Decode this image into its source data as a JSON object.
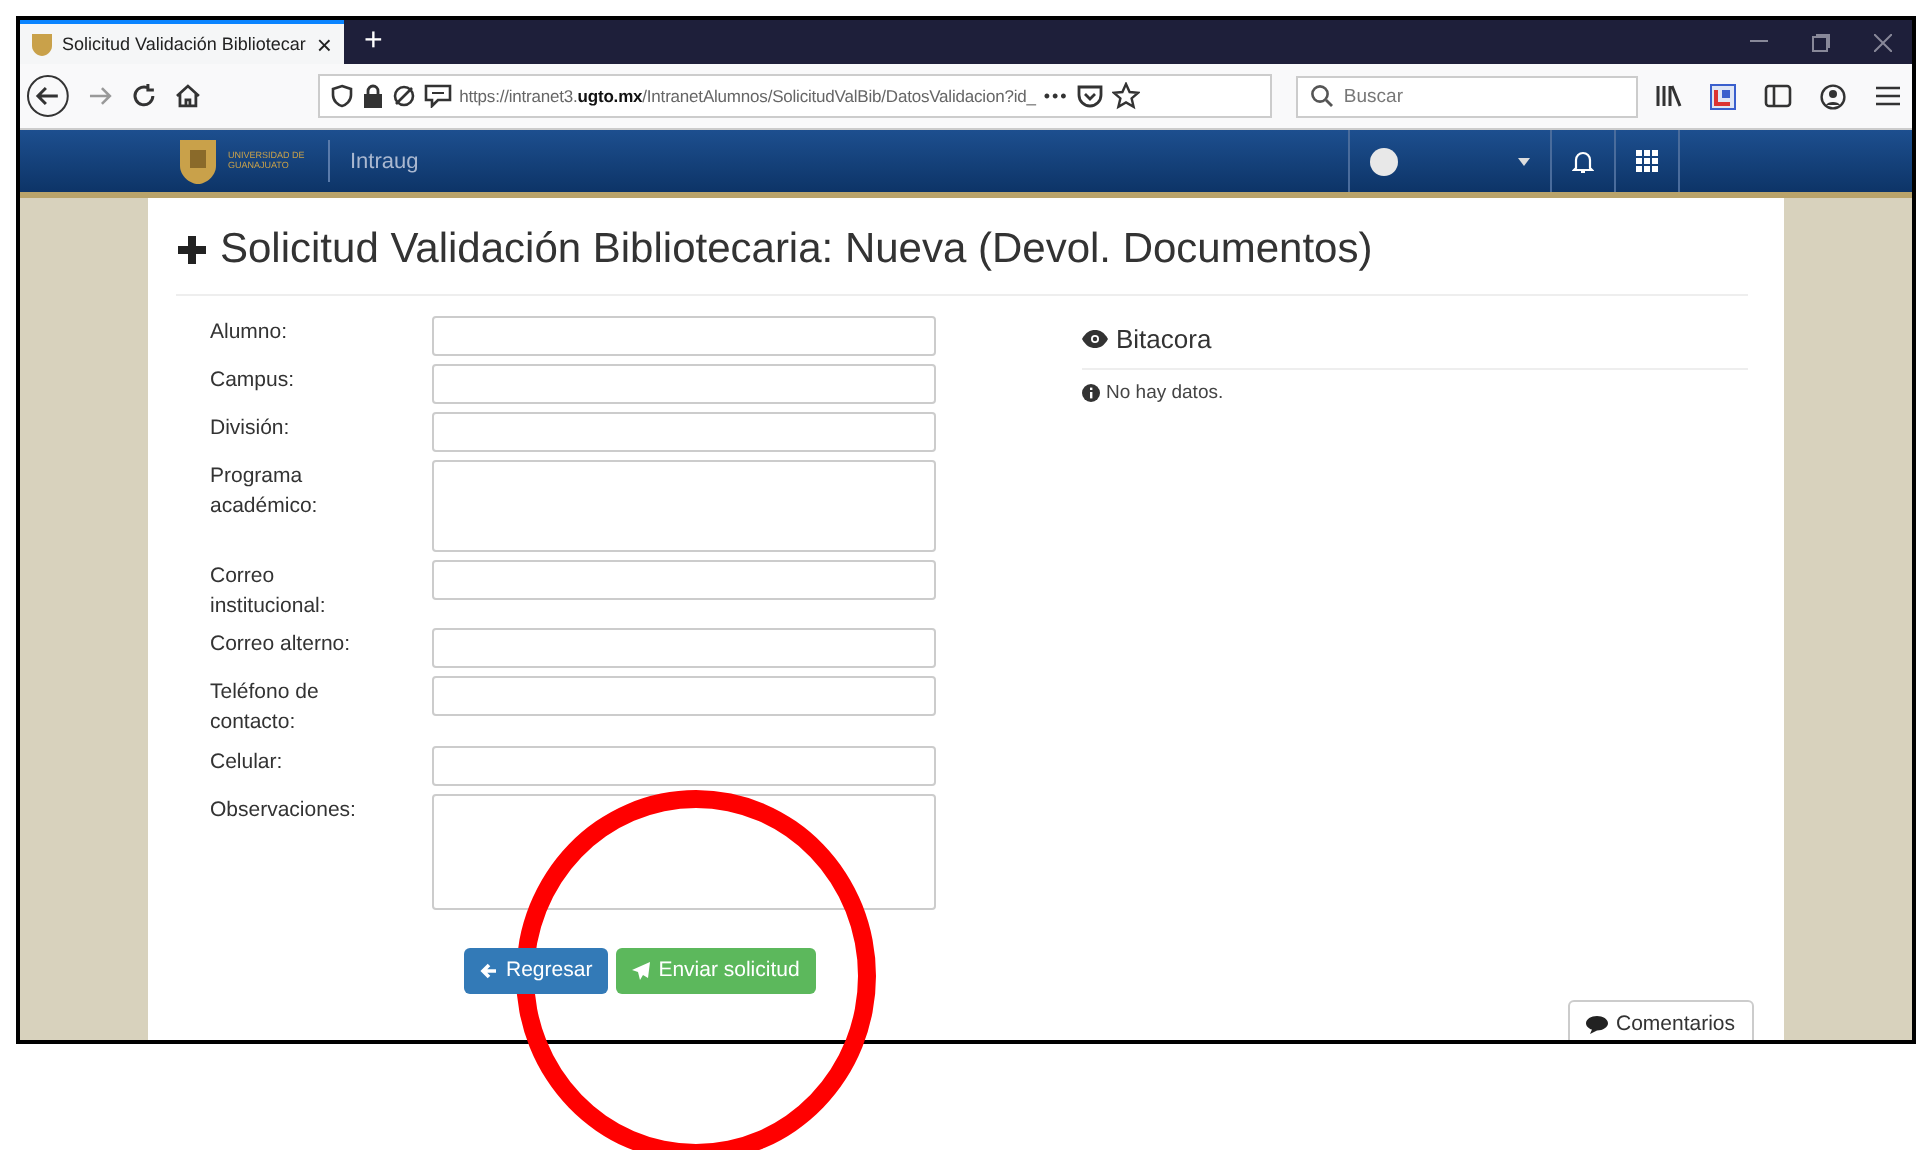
{
  "browser": {
    "tab_title": "Solicitud Validación Bibliotecar",
    "tab_close": "×",
    "new_tab": "+",
    "url": "https://intranet3.**ugto.mx**/IntranetAlumnos/SolicitudValBib/DatosValidacion?id_",
    "more": "•••",
    "search_placeholder": "Buscar"
  },
  "header": {
    "logo_text": "UNIVERSIDAD DE GUANAJUATO",
    "app_name": "Intraug"
  },
  "page": {
    "title": "Solicitud Validación Bibliotecaria: Nueva (Devol. Documentos)"
  },
  "form": {
    "fields": [
      {
        "label": "Alumno:",
        "kind": "input"
      },
      {
        "label": "Campus:",
        "kind": "input"
      },
      {
        "label": "División:",
        "kind": "input"
      },
      {
        "label": "Programa académico:",
        "kind": "textarea"
      },
      {
        "label": "Correo institucional:",
        "kind": "input"
      },
      {
        "label": "Correo alterno:",
        "kind": "input"
      },
      {
        "label": "Teléfono de contacto:",
        "kind": "input"
      },
      {
        "label": "Celular:",
        "kind": "input"
      },
      {
        "label": "Observaciones:",
        "kind": "textarea"
      }
    ],
    "buttons": [
      {
        "label": "Regresar",
        "kind": "back"
      },
      {
        "label": "Enviar solicitud",
        "kind": "send"
      }
    ]
  },
  "log": {
    "title": "Bitacora",
    "empty": "No hay datos."
  },
  "comments_button": "Comentarios",
  "annotation": {
    "kind": "circle"
  }
}
